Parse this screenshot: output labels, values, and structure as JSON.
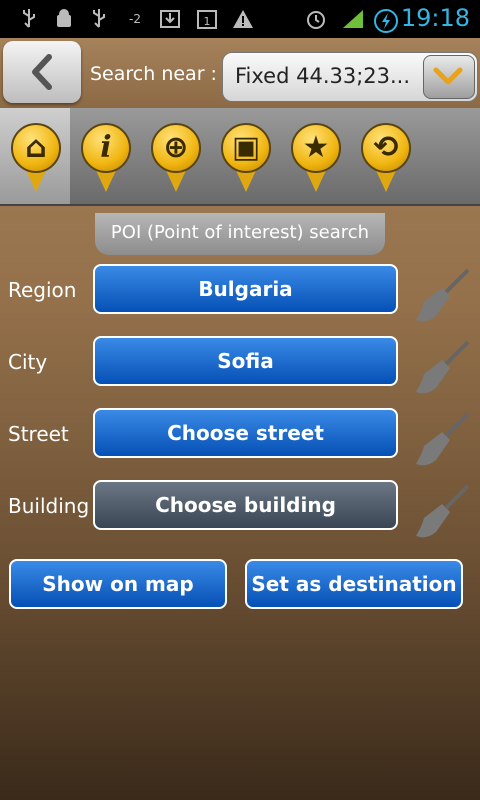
{
  "statusbar": {
    "time": "19:18",
    "icons": [
      "usb-icon",
      "android-debug-icon",
      "usb-icon",
      "signal-minus-icon",
      "download-icon",
      "calendar-icon",
      "warning-icon",
      "alarm-icon",
      "cell-signal-icon",
      "sync-icon"
    ],
    "notif_text": "-2"
  },
  "topbar": {
    "back_icon": "chevron-left-icon",
    "search_label": "Search near :",
    "location_value": "Fixed 44.33;23...",
    "dropdown_icon": "chevron-down-icon"
  },
  "categories": [
    {
      "name": "home",
      "icon": "home-icon",
      "glyph": "⌂"
    },
    {
      "name": "info",
      "icon": "info-icon",
      "glyph": "i"
    },
    {
      "name": "globe",
      "icon": "globe-icon",
      "glyph": "⊕"
    },
    {
      "name": "transport",
      "icon": "bus-icon",
      "glyph": "▣"
    },
    {
      "name": "favorites",
      "icon": "star-icon",
      "glyph": "★"
    },
    {
      "name": "history",
      "icon": "history-icon",
      "glyph": "⟲"
    }
  ],
  "poi_tab": {
    "title": "POI (Point of interest) search"
  },
  "fields": [
    {
      "label": "Region",
      "value": "Bulgaria",
      "enabled": true
    },
    {
      "label": "City",
      "value": "Sofia",
      "enabled": true
    },
    {
      "label": "Street",
      "value": "Choose street",
      "enabled": true
    },
    {
      "label": "Building",
      "value": "Choose building",
      "enabled": false
    }
  ],
  "actions": {
    "show_on_map": "Show on map",
    "set_destination": "Set as destination"
  },
  "colors": {
    "button_blue": "#0a5fc4",
    "button_disabled": "#4a5565",
    "time_blue": "#33b5e5",
    "pin_yellow": "#f0b510"
  }
}
